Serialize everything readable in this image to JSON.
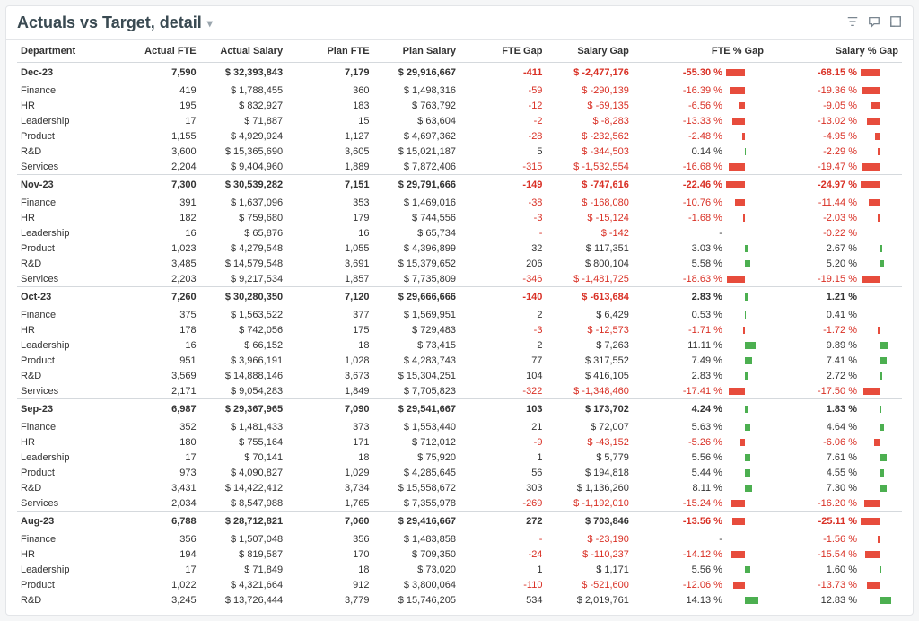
{
  "title": "Actuals vs Target, detail",
  "columns": [
    "Department",
    "Actual FTE",
    "Actual Salary",
    "Plan FTE",
    "Plan Salary",
    "FTE Gap",
    "Salary Gap",
    "FTE % Gap",
    "Salary % Gap"
  ],
  "groups": [
    {
      "label": "Dec-23",
      "summary": {
        "actual_fte": "7,590",
        "actual_salary": "$ 32,393,843",
        "plan_fte": "7,179",
        "plan_salary": "$ 29,916,667",
        "fte_gap": "-411",
        "salary_gap": "$ -2,477,176",
        "fte_pct": "-55.30 %",
        "salary_pct": "-68.15 %",
        "fte_pct_v": -55.3,
        "salary_pct_v": -68.15
      },
      "rows": [
        {
          "dept": "Finance",
          "actual_fte": "419",
          "actual_salary": "$ 1,788,455",
          "plan_fte": "360",
          "plan_salary": "$ 1,498,316",
          "fte_gap": "-59",
          "salary_gap": "$ -290,139",
          "fte_pct": "-16.39 %",
          "salary_pct": "-19.36 %",
          "fte_pct_v": -16.39,
          "salary_pct_v": -19.36
        },
        {
          "dept": "HR",
          "actual_fte": "195",
          "actual_salary": "$ 832,927",
          "plan_fte": "183",
          "plan_salary": "$ 763,792",
          "fte_gap": "-12",
          "salary_gap": "$ -69,135",
          "fte_pct": "-6.56 %",
          "salary_pct": "-9.05 %",
          "fte_pct_v": -6.56,
          "salary_pct_v": -9.05
        },
        {
          "dept": "Leadership",
          "actual_fte": "17",
          "actual_salary": "$ 71,887",
          "plan_fte": "15",
          "plan_salary": "$ 63,604",
          "fte_gap": "-2",
          "salary_gap": "$ -8,283",
          "fte_pct": "-13.33 %",
          "salary_pct": "-13.02 %",
          "fte_pct_v": -13.33,
          "salary_pct_v": -13.02
        },
        {
          "dept": "Product",
          "actual_fte": "1,155",
          "actual_salary": "$ 4,929,924",
          "plan_fte": "1,127",
          "plan_salary": "$ 4,697,362",
          "fte_gap": "-28",
          "salary_gap": "$ -232,562",
          "fte_pct": "-2.48 %",
          "salary_pct": "-4.95 %",
          "fte_pct_v": -2.48,
          "salary_pct_v": -4.95
        },
        {
          "dept": "R&D",
          "actual_fte": "3,600",
          "actual_salary": "$ 15,365,690",
          "plan_fte": "3,605",
          "plan_salary": "$ 15,021,187",
          "fte_gap": "5",
          "salary_gap": "$ -344,503",
          "fte_pct": "0.14 %",
          "salary_pct": "-2.29 %",
          "fte_pct_v": 0.14,
          "salary_pct_v": -2.29
        },
        {
          "dept": "Services",
          "actual_fte": "2,204",
          "actual_salary": "$ 9,404,960",
          "plan_fte": "1,889",
          "plan_salary": "$ 7,872,406",
          "fte_gap": "-315",
          "salary_gap": "$ -1,532,554",
          "fte_pct": "-16.68 %",
          "salary_pct": "-19.47 %",
          "fte_pct_v": -16.68,
          "salary_pct_v": -19.47
        }
      ]
    },
    {
      "label": "Nov-23",
      "summary": {
        "actual_fte": "7,300",
        "actual_salary": "$ 30,539,282",
        "plan_fte": "7,151",
        "plan_salary": "$ 29,791,666",
        "fte_gap": "-149",
        "salary_gap": "$ -747,616",
        "fte_pct": "-22.46 %",
        "salary_pct": "-24.97 %",
        "fte_pct_v": -22.46,
        "salary_pct_v": -24.97
      },
      "rows": [
        {
          "dept": "Finance",
          "actual_fte": "391",
          "actual_salary": "$ 1,637,096",
          "plan_fte": "353",
          "plan_salary": "$ 1,469,016",
          "fte_gap": "-38",
          "salary_gap": "$ -168,080",
          "fte_pct": "-10.76 %",
          "salary_pct": "-11.44 %",
          "fte_pct_v": -10.76,
          "salary_pct_v": -11.44
        },
        {
          "dept": "HR",
          "actual_fte": "182",
          "actual_salary": "$ 759,680",
          "plan_fte": "179",
          "plan_salary": "$ 744,556",
          "fte_gap": "-3",
          "salary_gap": "$ -15,124",
          "fte_pct": "-1.68 %",
          "salary_pct": "-2.03 %",
          "fte_pct_v": -1.68,
          "salary_pct_v": -2.03
        },
        {
          "dept": "Leadership",
          "actual_fte": "16",
          "actual_salary": "$ 65,876",
          "plan_fte": "16",
          "plan_salary": "$ 65,734",
          "fte_gap": "-",
          "salary_gap": "$ -142",
          "fte_pct": "-",
          "salary_pct": "-0.22 %",
          "fte_pct_v": 0,
          "salary_pct_v": -0.22
        },
        {
          "dept": "Product",
          "actual_fte": "1,023",
          "actual_salary": "$ 4,279,548",
          "plan_fte": "1,055",
          "plan_salary": "$ 4,396,899",
          "fte_gap": "32",
          "salary_gap": "$ 117,351",
          "fte_pct": "3.03 %",
          "salary_pct": "2.67 %",
          "fte_pct_v": 3.03,
          "salary_pct_v": 2.67
        },
        {
          "dept": "R&D",
          "actual_fte": "3,485",
          "actual_salary": "$ 14,579,548",
          "plan_fte": "3,691",
          "plan_salary": "$ 15,379,652",
          "fte_gap": "206",
          "salary_gap": "$ 800,104",
          "fte_pct": "5.58 %",
          "salary_pct": "5.20 %",
          "fte_pct_v": 5.58,
          "salary_pct_v": 5.2
        },
        {
          "dept": "Services",
          "actual_fte": "2,203",
          "actual_salary": "$ 9,217,534",
          "plan_fte": "1,857",
          "plan_salary": "$ 7,735,809",
          "fte_gap": "-346",
          "salary_gap": "$ -1,481,725",
          "fte_pct": "-18.63 %",
          "salary_pct": "-19.15 %",
          "fte_pct_v": -18.63,
          "salary_pct_v": -19.15
        }
      ]
    },
    {
      "label": "Oct-23",
      "summary": {
        "actual_fte": "7,260",
        "actual_salary": "$ 30,280,350",
        "plan_fte": "7,120",
        "plan_salary": "$ 29,666,666",
        "fte_gap": "-140",
        "salary_gap": "$ -613,684",
        "fte_pct": "2.83 %",
        "salary_pct": "1.21 %",
        "fte_pct_v": 2.83,
        "salary_pct_v": 1.21
      },
      "rows": [
        {
          "dept": "Finance",
          "actual_fte": "375",
          "actual_salary": "$ 1,563,522",
          "plan_fte": "377",
          "plan_salary": "$ 1,569,951",
          "fte_gap": "2",
          "salary_gap": "$ 6,429",
          "fte_pct": "0.53 %",
          "salary_pct": "0.41 %",
          "fte_pct_v": 0.53,
          "salary_pct_v": 0.41
        },
        {
          "dept": "HR",
          "actual_fte": "178",
          "actual_salary": "$ 742,056",
          "plan_fte": "175",
          "plan_salary": "$ 729,483",
          "fte_gap": "-3",
          "salary_gap": "$ -12,573",
          "fte_pct": "-1.71 %",
          "salary_pct": "-1.72 %",
          "fte_pct_v": -1.71,
          "salary_pct_v": -1.72
        },
        {
          "dept": "Leadership",
          "actual_fte": "16",
          "actual_salary": "$ 66,152",
          "plan_fte": "18",
          "plan_salary": "$ 73,415",
          "fte_gap": "2",
          "salary_gap": "$ 7,263",
          "fte_pct": "11.11 %",
          "salary_pct": "9.89 %",
          "fte_pct_v": 11.11,
          "salary_pct_v": 9.89
        },
        {
          "dept": "Product",
          "actual_fte": "951",
          "actual_salary": "$ 3,966,191",
          "plan_fte": "1,028",
          "plan_salary": "$ 4,283,743",
          "fte_gap": "77",
          "salary_gap": "$ 317,552",
          "fte_pct": "7.49 %",
          "salary_pct": "7.41 %",
          "fte_pct_v": 7.49,
          "salary_pct_v": 7.41
        },
        {
          "dept": "R&D",
          "actual_fte": "3,569",
          "actual_salary": "$ 14,888,146",
          "plan_fte": "3,673",
          "plan_salary": "$ 15,304,251",
          "fte_gap": "104",
          "salary_gap": "$ 416,105",
          "fte_pct": "2.83 %",
          "salary_pct": "2.72 %",
          "fte_pct_v": 2.83,
          "salary_pct_v": 2.72
        },
        {
          "dept": "Services",
          "actual_fte": "2,171",
          "actual_salary": "$ 9,054,283",
          "plan_fte": "1,849",
          "plan_salary": "$ 7,705,823",
          "fte_gap": "-322",
          "salary_gap": "$ -1,348,460",
          "fte_pct": "-17.41 %",
          "salary_pct": "-17.50 %",
          "fte_pct_v": -17.41,
          "salary_pct_v": -17.5
        }
      ]
    },
    {
      "label": "Sep-23",
      "summary": {
        "actual_fte": "6,987",
        "actual_salary": "$ 29,367,965",
        "plan_fte": "7,090",
        "plan_salary": "$ 29,541,667",
        "fte_gap": "103",
        "salary_gap": "$ 173,702",
        "fte_pct": "4.24 %",
        "salary_pct": "1.83 %",
        "fte_pct_v": 4.24,
        "salary_pct_v": 1.83
      },
      "rows": [
        {
          "dept": "Finance",
          "actual_fte": "352",
          "actual_salary": "$ 1,481,433",
          "plan_fte": "373",
          "plan_salary": "$ 1,553,440",
          "fte_gap": "21",
          "salary_gap": "$ 72,007",
          "fte_pct": "5.63 %",
          "salary_pct": "4.64 %",
          "fte_pct_v": 5.63,
          "salary_pct_v": 4.64
        },
        {
          "dept": "HR",
          "actual_fte": "180",
          "actual_salary": "$ 755,164",
          "plan_fte": "171",
          "plan_salary": "$ 712,012",
          "fte_gap": "-9",
          "salary_gap": "$ -43,152",
          "fte_pct": "-5.26 %",
          "salary_pct": "-6.06 %",
          "fte_pct_v": -5.26,
          "salary_pct_v": -6.06
        },
        {
          "dept": "Leadership",
          "actual_fte": "17",
          "actual_salary": "$ 70,141",
          "plan_fte": "18",
          "plan_salary": "$ 75,920",
          "fte_gap": "1",
          "salary_gap": "$ 5,779",
          "fte_pct": "5.56 %",
          "salary_pct": "7.61 %",
          "fte_pct_v": 5.56,
          "salary_pct_v": 7.61
        },
        {
          "dept": "Product",
          "actual_fte": "973",
          "actual_salary": "$ 4,090,827",
          "plan_fte": "1,029",
          "plan_salary": "$ 4,285,645",
          "fte_gap": "56",
          "salary_gap": "$ 194,818",
          "fte_pct": "5.44 %",
          "salary_pct": "4.55 %",
          "fte_pct_v": 5.44,
          "salary_pct_v": 4.55
        },
        {
          "dept": "R&D",
          "actual_fte": "3,431",
          "actual_salary": "$ 14,422,412",
          "plan_fte": "3,734",
          "plan_salary": "$ 15,558,672",
          "fte_gap": "303",
          "salary_gap": "$ 1,136,260",
          "fte_pct": "8.11 %",
          "salary_pct": "7.30 %",
          "fte_pct_v": 8.11,
          "salary_pct_v": 7.3
        },
        {
          "dept": "Services",
          "actual_fte": "2,034",
          "actual_salary": "$ 8,547,988",
          "plan_fte": "1,765",
          "plan_salary": "$ 7,355,978",
          "fte_gap": "-269",
          "salary_gap": "$ -1,192,010",
          "fte_pct": "-15.24 %",
          "salary_pct": "-16.20 %",
          "fte_pct_v": -15.24,
          "salary_pct_v": -16.2
        }
      ]
    },
    {
      "label": "Aug-23",
      "summary": {
        "actual_fte": "6,788",
        "actual_salary": "$ 28,712,821",
        "plan_fte": "7,060",
        "plan_salary": "$ 29,416,667",
        "fte_gap": "272",
        "salary_gap": "$ 703,846",
        "fte_pct": "-13.56 %",
        "salary_pct": "-25.11 %",
        "fte_pct_v": -13.56,
        "salary_pct_v": -25.11
      },
      "rows": [
        {
          "dept": "Finance",
          "actual_fte": "356",
          "actual_salary": "$ 1,507,048",
          "plan_fte": "356",
          "plan_salary": "$ 1,483,858",
          "fte_gap": "-",
          "salary_gap": "$ -23,190",
          "fte_pct": "-",
          "salary_pct": "-1.56 %",
          "fte_pct_v": 0,
          "salary_pct_v": -1.56
        },
        {
          "dept": "HR",
          "actual_fte": "194",
          "actual_salary": "$ 819,587",
          "plan_fte": "170",
          "plan_salary": "$ 709,350",
          "fte_gap": "-24",
          "salary_gap": "$ -110,237",
          "fte_pct": "-14.12 %",
          "salary_pct": "-15.54 %",
          "fte_pct_v": -14.12,
          "salary_pct_v": -15.54
        },
        {
          "dept": "Leadership",
          "actual_fte": "17",
          "actual_salary": "$ 71,849",
          "plan_fte": "18",
          "plan_salary": "$ 73,020",
          "fte_gap": "1",
          "salary_gap": "$ 1,171",
          "fte_pct": "5.56 %",
          "salary_pct": "1.60 %",
          "fte_pct_v": 5.56,
          "salary_pct_v": 1.6
        },
        {
          "dept": "Product",
          "actual_fte": "1,022",
          "actual_salary": "$ 4,321,664",
          "plan_fte": "912",
          "plan_salary": "$ 3,800,064",
          "fte_gap": "-110",
          "salary_gap": "$ -521,600",
          "fte_pct": "-12.06 %",
          "salary_pct": "-13.73 %",
          "fte_pct_v": -12.06,
          "salary_pct_v": -13.73
        },
        {
          "dept": "R&D",
          "actual_fte": "3,245",
          "actual_salary": "$ 13,726,444",
          "plan_fte": "3,779",
          "plan_salary": "$ 15,746,205",
          "fte_gap": "534",
          "salary_gap": "$ 2,019,761",
          "fte_pct": "14.13 %",
          "salary_pct": "12.83 %",
          "fte_pct_v": 14.13,
          "salary_pct_v": 12.83
        }
      ]
    }
  ]
}
